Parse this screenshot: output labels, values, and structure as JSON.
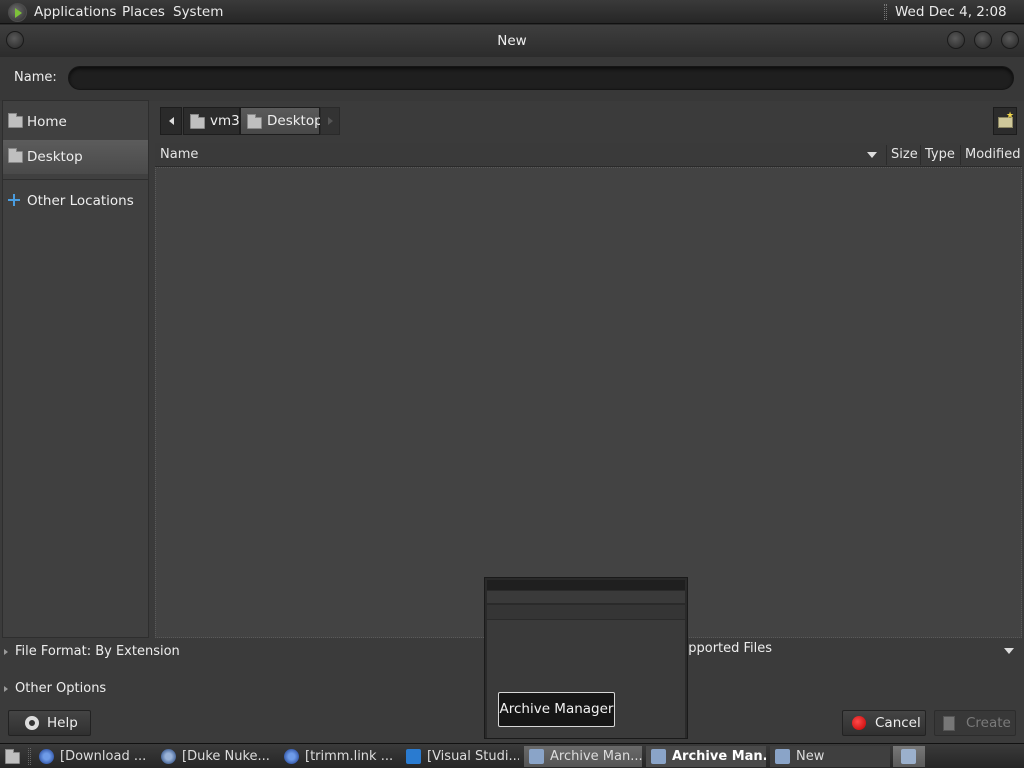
{
  "top_panel": {
    "menus": [
      "Applications",
      "Places",
      "System"
    ],
    "clock": "Wed Dec  4,  2:08 PM"
  },
  "dialog": {
    "title": "New",
    "name_label": "Name:",
    "name_value": "",
    "sidebar": {
      "items": [
        {
          "label": "Home",
          "icon": "folder-home-icon"
        },
        {
          "label": "Desktop",
          "icon": "folder-desktop-icon",
          "active": true
        },
        {
          "label": "Other Locations",
          "icon": "plus-icon"
        }
      ]
    },
    "path": [
      "vm3",
      "Desktop"
    ],
    "columns": {
      "name": "Name",
      "size": "Size",
      "type": "Type",
      "modified": "Modified"
    },
    "file_format": "File Format: By Extension",
    "filter": "upported Files",
    "other_options": "Other Options",
    "buttons": {
      "help": "Help",
      "cancel": "Cancel",
      "create": "Create"
    }
  },
  "tooltip": {
    "label": "Archive Manager"
  },
  "taskbar": {
    "tasks": [
      {
        "label": "[Download ...",
        "icon": "chrome-icon"
      },
      {
        "label": "[Duke Nuke...",
        "icon": "app-icon"
      },
      {
        "label": "[trimm.link ...",
        "icon": "chrome-icon"
      },
      {
        "label": "[Visual Studi...",
        "icon": "vscode-icon"
      },
      {
        "label": "Archive Man...",
        "icon": "archive-icon"
      },
      {
        "label": "Archive Man...",
        "icon": "archive-icon"
      },
      {
        "label": "New",
        "icon": "archive-icon"
      }
    ]
  },
  "colors": {
    "accent_blue": "#4a9de0",
    "cancel_red": "#e01010",
    "logo_green": "#7ec23a"
  }
}
